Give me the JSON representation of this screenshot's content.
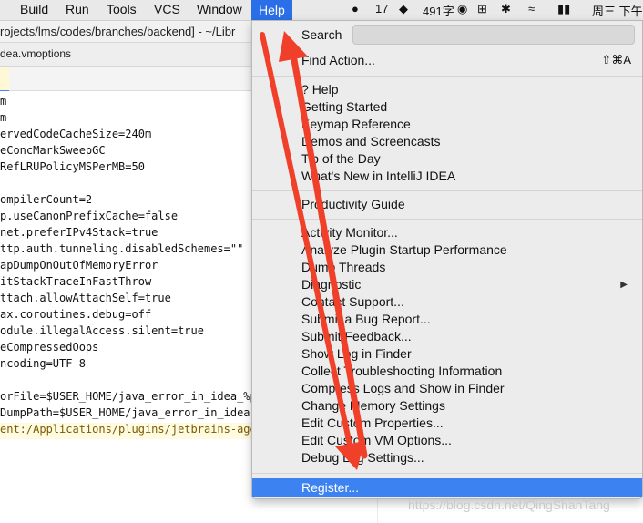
{
  "menubar": {
    "items": [
      "Build",
      "Run",
      "Tools",
      "VCS",
      "Window",
      "Help"
    ],
    "tray": {
      "notif_count": "17",
      "word_count": "491字",
      "clock": "周三 下午"
    }
  },
  "path_text": "rojects/lms/codes/branches/backend] - ~/Libr",
  "file_tab": "dea.vmoptions",
  "editor_lines": [
    "m",
    "m",
    "ervedCodeCacheSize=240m",
    "eConcMarkSweepGC",
    "RefLRUPolicyMSPerMB=50",
    "",
    "ompilerCount=2",
    "p.useCanonPrefixCache=false",
    "net.preferIPv4Stack=true",
    "ttp.auth.tunneling.disabledSchemes=\"\"",
    "apDumpOnOutOfMemoryError",
    "itStackTraceInFastThrow",
    "ttach.allowAttachSelf=true",
    "ax.coroutines.debug=off",
    "odule.illegalAccess.silent=true",
    "eCompressedOops",
    "ncoding=UTF-8",
    "",
    "",
    "orFile=$USER_HOME/java_error_in_idea_%p.",
    "DumpPath=$USER_HOME/java_error_in_idea.",
    "ent:/Applications/plugins/jetbrains-agen"
  ],
  "help_menu": {
    "search_label": "Search",
    "find_action": "Find Action...",
    "find_action_shortcut": "⇧⌘A",
    "group1": [
      "Help",
      "Getting Started",
      "Keymap Reference",
      "Demos and Screencasts",
      "Tip of the Day",
      "What's New in IntelliJ IDEA"
    ],
    "group2": [
      "Productivity Guide"
    ],
    "group3": [
      "Activity Monitor...",
      "Analyze Plugin Startup Performance",
      "Dump Threads",
      "Diagnostic",
      "Contact Support...",
      "Submit a Bug Report...",
      "Submit Feedback...",
      "Show Log in Finder",
      "Collect Troubleshooting Information",
      "Compress Logs and Show in Finder",
      "Change Memory Settings",
      "Edit Custom Properties...",
      "Edit Custom VM Options...",
      "Debug Log Settings..."
    ],
    "register": "Register..."
  },
  "watermark": "https://blog.csdn.net/QingShanTang",
  "colors": {
    "accent": "#3c82f0",
    "annotation": "#f0402a"
  }
}
